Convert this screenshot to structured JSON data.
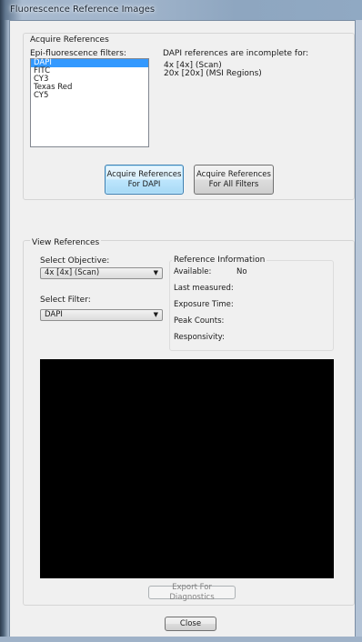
{
  "window": {
    "title": "Fluorescence Reference Images"
  },
  "acquire": {
    "group_label": "Acquire References",
    "filters_label": "Epi-fluorescence filters:",
    "filters": [
      "DAPI",
      "FITC",
      "CY3",
      "Texas Red",
      "CY5"
    ],
    "selected_filter": "DAPI",
    "incomplete_label": "DAPI references are incomplete for:",
    "incomplete_items": [
      "4x [4x]  (Scan)",
      "20x [20x]  (MSI Regions)"
    ],
    "btn_dapi_line1": "Acquire References",
    "btn_dapi_line2": "For DAPI",
    "btn_all_line1": "Acquire References",
    "btn_all_line2": "For All Filters"
  },
  "view": {
    "group_label": "View References",
    "objective_label": "Select Objective:",
    "objective_value": "4x [4x]  (Scan)",
    "filter_label": "Select Filter:",
    "filter_value": "DAPI",
    "info_group_label": "Reference Information",
    "available_label": "Available:",
    "available_value": "No",
    "last_measured_label": "Last measured:",
    "exposure_label": "Exposure Time:",
    "peak_label": "Peak Counts:",
    "responsivity_label": "Responsivity:",
    "export_label": "Export For Diagnostics"
  },
  "footer": {
    "close_label": "Close"
  },
  "colors": {
    "selection": "#3399ff",
    "image_bg": "#000000",
    "title_bar": "#9fb3ca"
  }
}
